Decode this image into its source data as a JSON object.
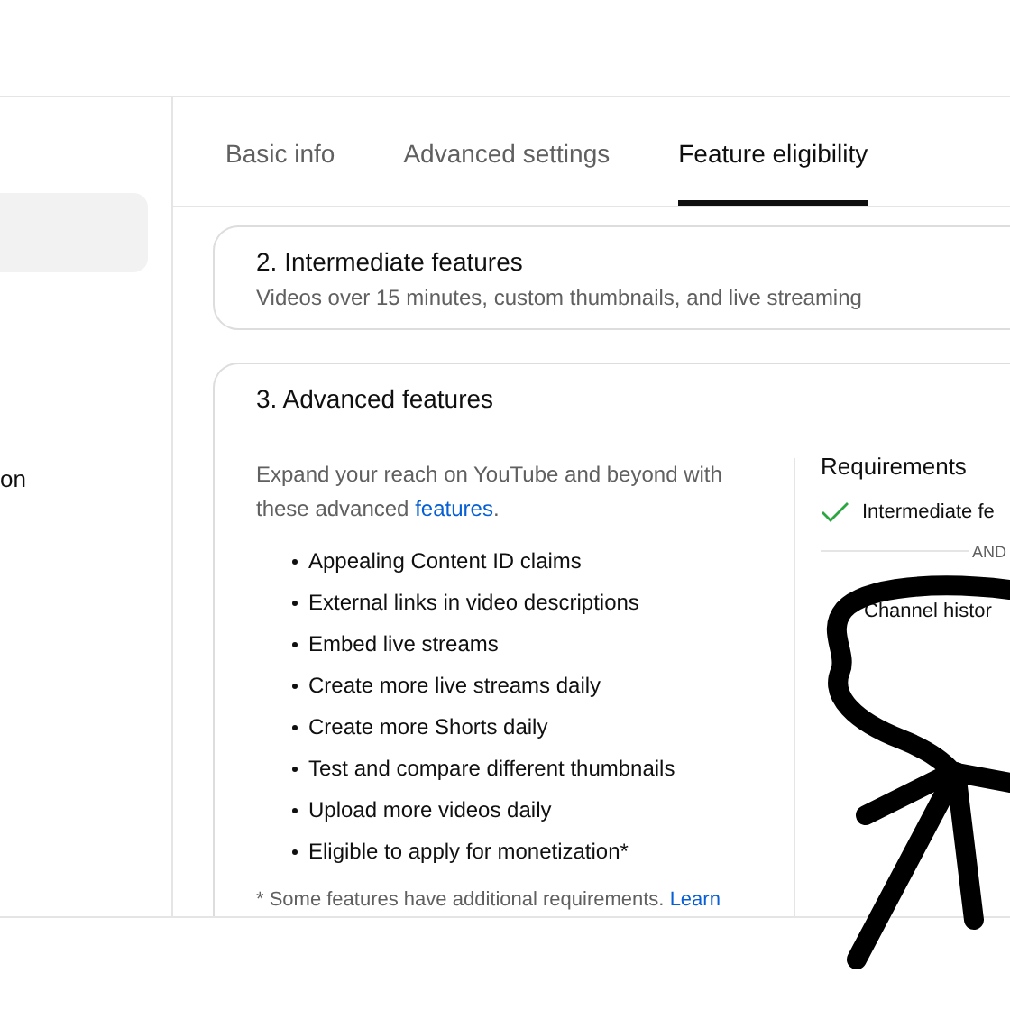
{
  "sidebar": {
    "items": [
      {
        "selected": true
      },
      {
        "label": "on",
        "selected": false
      }
    ]
  },
  "tabs": [
    {
      "label": "Basic info",
      "selected": false
    },
    {
      "label": "Advanced settings",
      "selected": false
    },
    {
      "label": "Feature eligibility",
      "selected": true
    }
  ],
  "cards": [
    {
      "title": "2. Intermediate features",
      "subtitle": "Videos over 15 minutes, custom thumbnails, and live streaming"
    },
    {
      "title": "3. Advanced features",
      "intro": "Expand your reach on YouTube and beyond with these advanced ",
      "intro_link": "features",
      "intro_end": ".",
      "features": [
        "Appealing Content ID claims",
        "External links in video descriptions",
        "Embed live streams",
        "Create more live streams daily",
        "Create more Shorts daily",
        "Test and compare different thumbnails",
        "Upload more videos daily",
        "Eligible to apply for monetization*"
      ],
      "footnote": "* Some features have additional requirements. ",
      "footnote_link": "Learn",
      "requirements": {
        "heading": "Requirements",
        "items": [
          {
            "label": "Intermediate fe",
            "met": true
          }
        ],
        "joiner": "AND",
        "pending": "Channel histor"
      }
    }
  ]
}
